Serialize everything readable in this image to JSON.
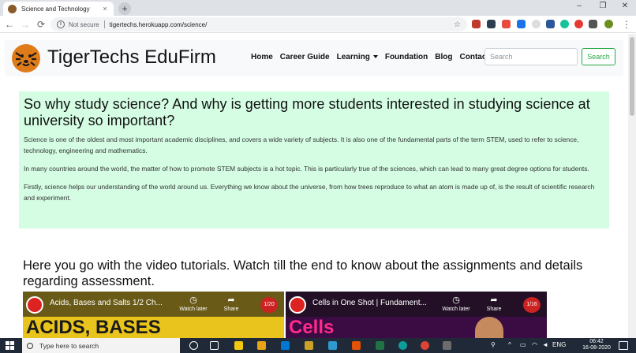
{
  "browser": {
    "tab_title": "Science and Technology",
    "tab_close": "×",
    "new_tab": "+",
    "window_controls": [
      "–",
      "❐",
      "✕"
    ],
    "nav_back": "←",
    "nav_forward": "→",
    "nav_reload": "⟳",
    "security_label": "Not secure",
    "url": "tigertechs.herokuapp.com/science/",
    "bookmark_icon": "☆",
    "menu_icon": "⋮"
  },
  "site": {
    "brand": "TigerTechs EduFirm",
    "nav": [
      {
        "label": "Home"
      },
      {
        "label": "Career Guide"
      },
      {
        "label": "Learning"
      },
      {
        "label": "Foundation"
      },
      {
        "label": "Blog"
      },
      {
        "label": "Contact"
      }
    ],
    "search": {
      "placeholder": "Search",
      "button": "Search"
    }
  },
  "intro": {
    "heading": "So why study science? And why is getting more students interested in studying science at university so important?",
    "paragraphs": [
      "Science is one of the oldest and most important academic disciplines, and covers a wide variety of subjects. It is also one of the fundamental parts of the term STEM, used to refer to science, technology, engineering and mathematics.",
      "In many countries around the world, the matter of how to promote STEM subjects is a hot topic. This is particularly true of the sciences, which can lead to many great degree options for students.",
      "Firstly, science helps our understanding of the world around us. Everything we know about the universe, from how trees reproduce to what an atom is made up of, is the result of scientific research and experiment."
    ]
  },
  "videos": {
    "heading": "Here you go with the video tutorials. Watch till the end to know about the assignments and details regarding assessment.",
    "items": [
      {
        "title": "Acids, Bases and Salts 1/2 Ch...",
        "watch_later": "Watch later",
        "share": "Share",
        "count": "1/20",
        "banner": "ACIDS, BASES"
      },
      {
        "title": "Cells in One Shot | Fundament...",
        "watch_later": "Watch later",
        "share": "Share",
        "count": "1/16",
        "banner": "Cells"
      }
    ]
  },
  "taskbar": {
    "search_placeholder": "Type here to search",
    "language": "ENG",
    "time": "06:42",
    "date": "16-08-2020"
  }
}
